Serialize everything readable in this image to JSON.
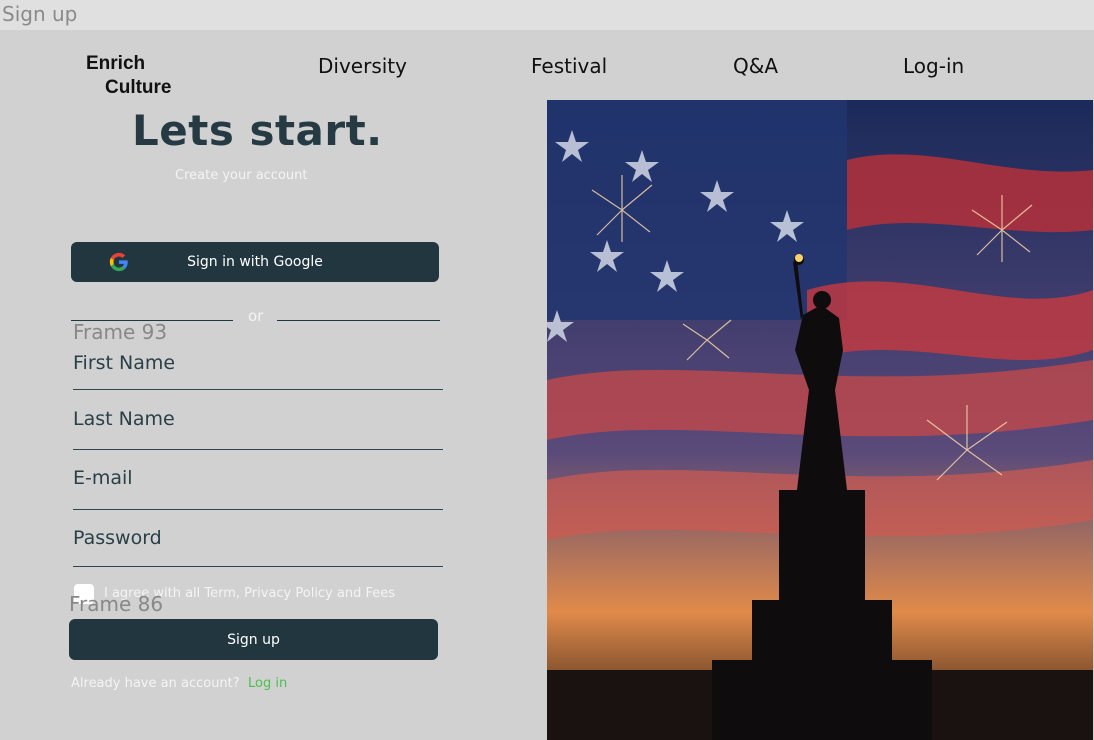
{
  "frame": {
    "title": "Sign up"
  },
  "nav": {
    "logo_line1": "Enrich",
    "logo_line2": "Culture",
    "items": [
      {
        "label": "Diversity"
      },
      {
        "label": "Festival"
      },
      {
        "label": "Q&A"
      },
      {
        "label": "Log-in"
      }
    ]
  },
  "form": {
    "headline": "Lets start.",
    "subheadline": "Create your account",
    "google_button": "Sign in with Google",
    "divider": "or",
    "frame_label_top": "Frame 93",
    "frame_label_bottom": "Frame 86",
    "first_name": "First Name",
    "last_name": "Last Name",
    "email": "E-mail",
    "password": "Password",
    "agree_text": "I agree with all Term, Privacy Policy and Fees",
    "signup_button": "Sign up",
    "account_text": "Already have an account?",
    "login_link": "Log in"
  },
  "colors": {
    "primary": "#223640",
    "link": "#4cc04c",
    "background": "#d1d1d1"
  }
}
